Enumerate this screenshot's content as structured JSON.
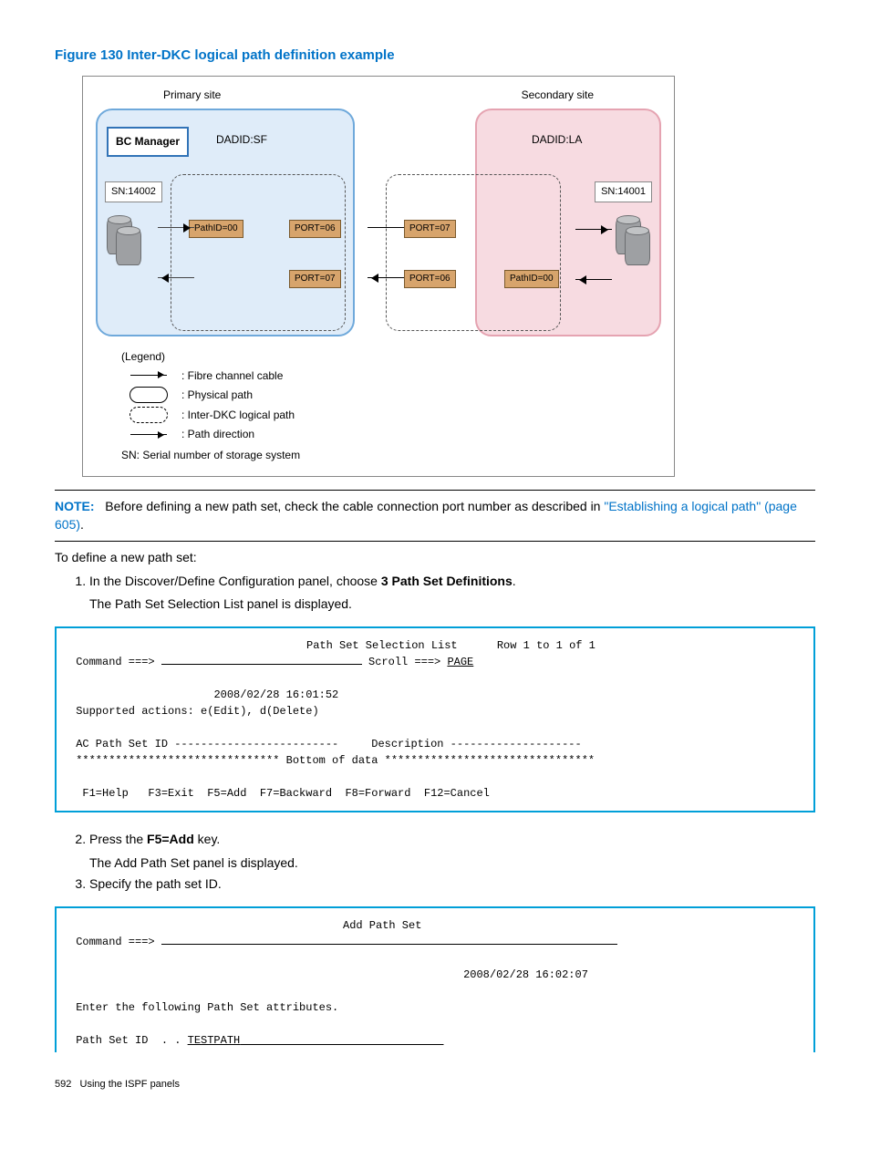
{
  "figure": {
    "title": "Figure 130 Inter-DKC logical path definition example",
    "primary_label": "Primary site",
    "secondary_label": "Secondary site",
    "bc_manager": "BC Manager",
    "dadid_sf": "DADID:SF",
    "dadid_la": "DADID:LA",
    "sn_left": "SN:14002",
    "sn_right": "SN:14001",
    "pathid_left": "PathID=00",
    "pathid_right": "PathID=00",
    "port06": "PORT=06",
    "port07": "PORT=07",
    "legend_title": "(Legend)",
    "legend_fibre": ": Fibre channel cable",
    "legend_physical": ": Physical path",
    "legend_interdkc": ": Inter-DKC logical path",
    "legend_direction": ": Path direction",
    "legend_sn": "SN: Serial number of  storage system"
  },
  "note": {
    "label": "NOTE:",
    "text": "Before defining a new path set, check the cable connection port number as described in ",
    "link": "\"Establishing a logical path\" (page 605)",
    "suffix": "."
  },
  "intro": "To define a new path set:",
  "steps": {
    "s1_a": "In the Discover/Define Configuration panel, choose ",
    "s1_b": "3 Path Set Definitions",
    "s1_c": ".",
    "s1_sub": "The Path Set Selection List panel is displayed.",
    "s2_a": "Press the ",
    "s2_b": "F5=Add",
    "s2_c": " key.",
    "s2_sub": "The Add Path Set panel is displayed.",
    "s3": "Specify the path set ID."
  },
  "panel1": {
    "title": "Path Set Selection List",
    "row_info": "Row 1 to 1 of 1",
    "cmd_label": " Command ===> ",
    "scroll_label": " Scroll ===> ",
    "scroll_val": "PAGE",
    "timestamp": "2008/02/28 16:01:52",
    "supported": " Supported actions: e(Edit), d(Delete)",
    "header": " AC Path Set ID -------------------------     Description --------------------",
    "bottom": " ******************************* Bottom of data ********************************",
    "fkeys": "  F1=Help   F3=Exit  F5=Add  F7=Backward  F8=Forward  F12=Cancel"
  },
  "panel2": {
    "title": "Add Path Set",
    "cmd_label": " Command ===> ",
    "timestamp": "2008/02/28 16:02:07",
    "prompt": " Enter the following Path Set attributes.",
    "pathset_label": " Path Set ID  . . ",
    "pathset_val": "TESTPATH"
  },
  "footer": {
    "page": "592",
    "section": "Using the ISPF panels"
  }
}
